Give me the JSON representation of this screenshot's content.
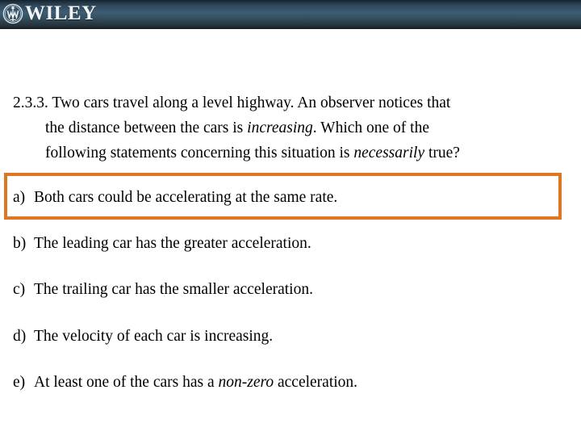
{
  "header": {
    "brand_name": "WILEY",
    "emblem_name": "wiley-crest-emblem",
    "gradient_top": "#16222e",
    "gradient_mid": "#3e5d74",
    "gradient_bottom": "#131a20"
  },
  "question": {
    "number": "2.3.3.",
    "line1": "2.3.3. Two cars travel along a level highway.  An observer notices that",
    "line2_pre": "the distance between the cars is ",
    "line2_em": "increasing",
    "line2_post": ".  Which one of the",
    "line3_pre": "following statements concerning this situation is ",
    "line3_em": "necessarily",
    "line3_post": " true?"
  },
  "choices": [
    {
      "marker": "a)",
      "text": "Both cars could be accelerating at the same rate.",
      "highlighted": true
    },
    {
      "marker": "b)",
      "text": "The leading car has the greater acceleration.",
      "highlighted": false
    },
    {
      "marker": "c)",
      "text": "The trailing car has the smaller acceleration.",
      "highlighted": false
    },
    {
      "marker": "d)",
      "text": "The velocity of each car is increasing.",
      "highlighted": false
    },
    {
      "marker": "e)",
      "text_pre": "At least one of the cars has a ",
      "text_em": "non-zero",
      "text_post": " acceleration.",
      "highlighted": false
    }
  ],
  "highlight": {
    "color": "#DD7722",
    "border_width_px": 4,
    "target_choice": "a)"
  },
  "colors": {
    "page_background": "#ffffff",
    "text": "#000000",
    "accent_orange": "#DD7722",
    "header_text": "#f2f5f7"
  }
}
